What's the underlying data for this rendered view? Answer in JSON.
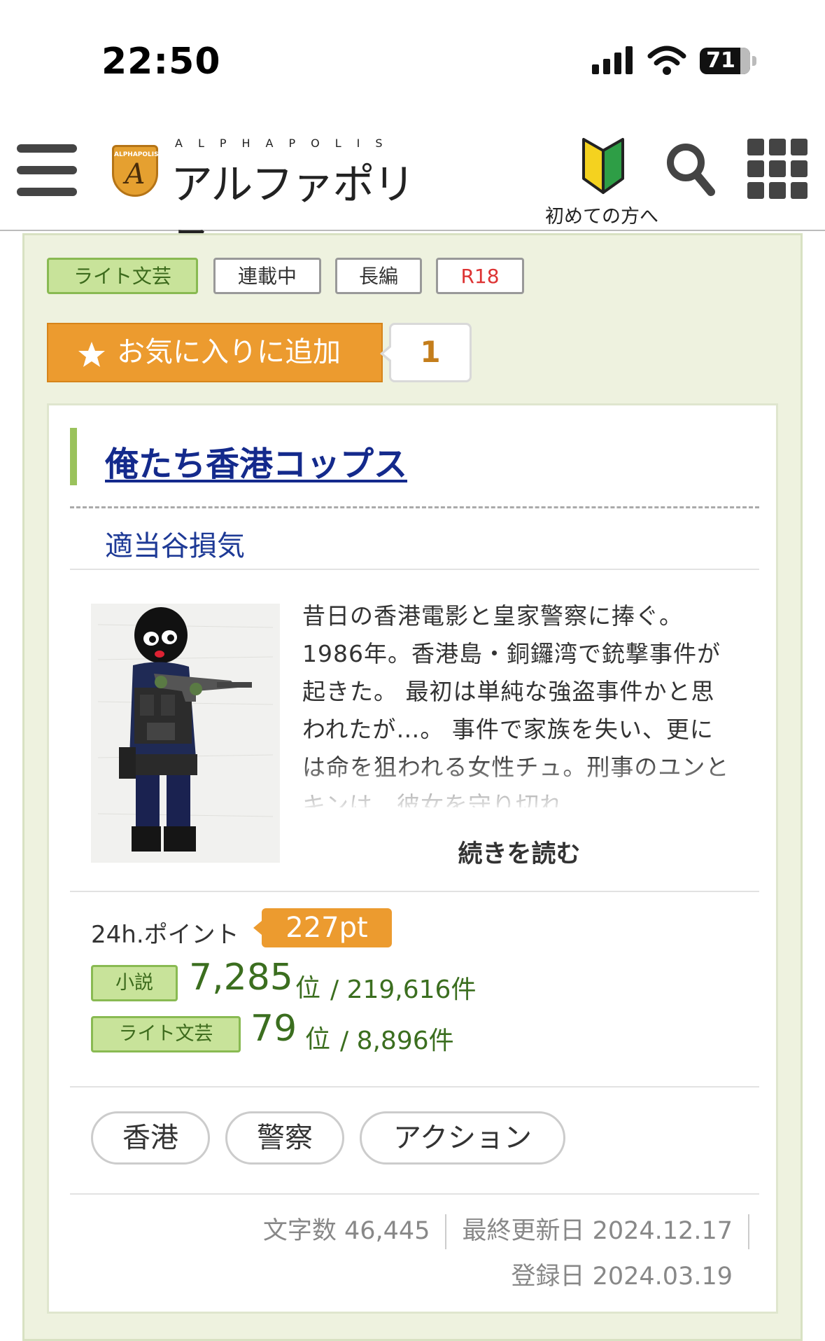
{
  "status_bar": {
    "time": "22:50",
    "battery": "71"
  },
  "header": {
    "logo_latin": "ALPHAPOLIS",
    "logo_jp": "アルファポリス",
    "logo_emblem_text": "ALPHAPOLIS",
    "beginner_label": "初めての方へ",
    "icons": [
      "menu-icon",
      "beginner-mark-icon",
      "search-icon",
      "grid-menu-icon"
    ]
  },
  "tags": [
    "ライト文芸",
    "連載中",
    "長編",
    "R18"
  ],
  "favorite": {
    "label": "お気に入りに追加",
    "count": "1"
  },
  "work": {
    "title": "俺たち香港コップス",
    "author": "適当谷損気",
    "synopsis": "昔日の香港電影と皇家警察に捧ぐ。1986年。香港島・銅鑼湾で銃撃事件が起きた。 最初は単純な強盗事件かと思われたが…。 事件で家族を失い、更には命を狙われる女性チュ。刑事のユンとキンは、彼女を守り切れ",
    "read_more": "続きを読む",
    "points_label": "24h.ポイント",
    "points_value": "227pt",
    "rankings": [
      {
        "category": "小説",
        "rank": "7,285",
        "unit": "位",
        "total": "/ 219,616件"
      },
      {
        "category": "ライト文芸",
        "rank": "79",
        "unit": "位",
        "total": "/ 8,896件"
      }
    ],
    "keywords": [
      "香港",
      "警察",
      "アクション"
    ],
    "char_count_label": "文字数 46,445",
    "updated_label": "最終更新日 2024.12.17",
    "registered_label": "登録日 2024.03.19"
  },
  "colors": {
    "accent_orange": "#ec9b2f",
    "tag_green": "#c8e39a",
    "title_blue": "#142a8c",
    "panel_bg": "#eef2df",
    "r18_red": "#dd3333"
  }
}
